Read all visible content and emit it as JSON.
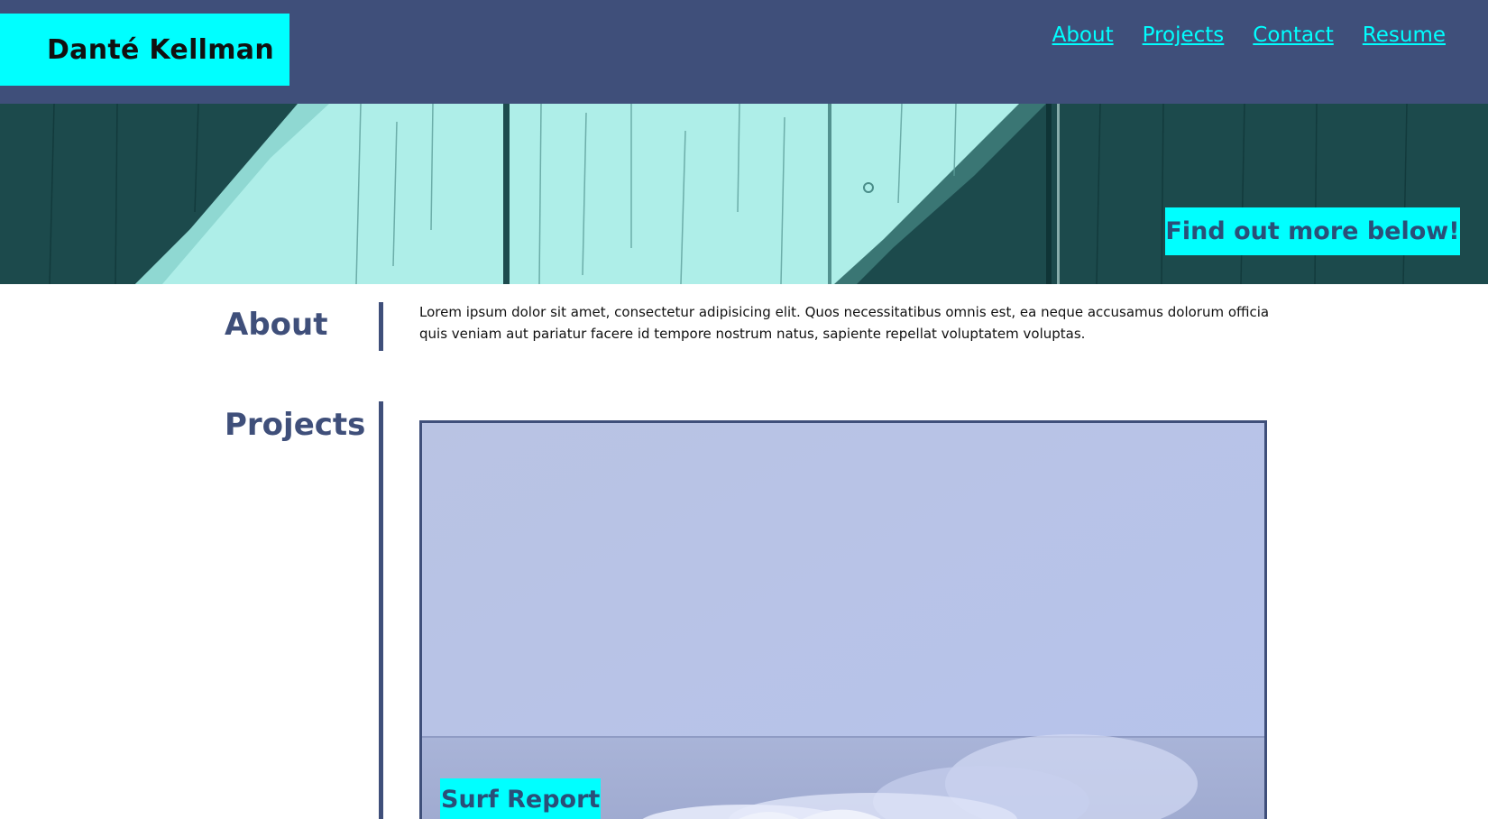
{
  "header": {
    "brand": "Danté Kellman",
    "nav": [
      {
        "label": "About"
      },
      {
        "label": "Projects"
      },
      {
        "label": "Contact"
      },
      {
        "label": "Resume"
      }
    ]
  },
  "hero": {
    "cta": "Find out more below!"
  },
  "about": {
    "title": "About",
    "text": "Lorem ipsum dolor sit amet, consectetur adipisicing elit. Quos necessitatibus omnis est, ea neque accusamus dolorum officia quis veniam aut pariatur facere id tempore nostrum natus, sapiente repellat voluptatem voluptas."
  },
  "projects": {
    "title": "Projects",
    "items": [
      {
        "label": "Surf Report"
      }
    ]
  },
  "colors": {
    "header_bg": "#3f4f7a",
    "accent": "#00ffff",
    "section_title": "#3f4f7a"
  }
}
